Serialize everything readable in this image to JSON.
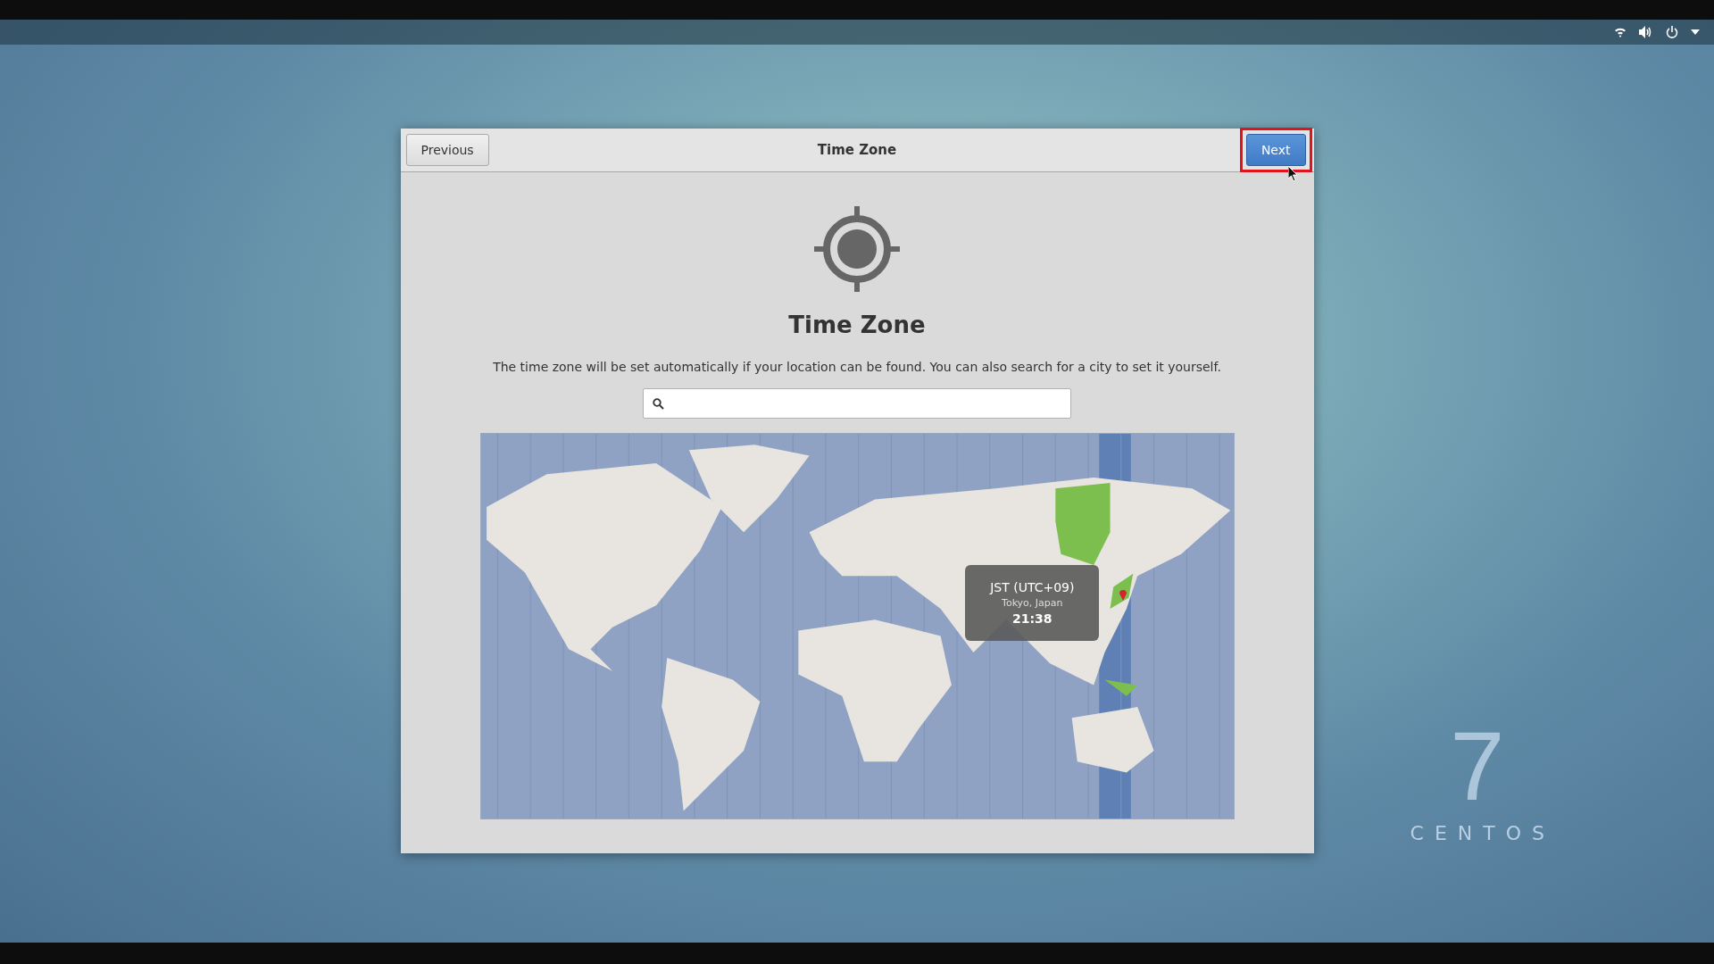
{
  "dialog": {
    "title": "Time Zone",
    "previous_button": "Previous",
    "next_button": "Next",
    "next_highlighted": true
  },
  "page": {
    "heading": "Time Zone",
    "description": "The time zone will be set automatically if your location can be found. You can also search for a city to set it yourself."
  },
  "map": {
    "tooltip": {
      "zone": "JST (UTC+09)",
      "city": "Tokyo, Japan",
      "time": "21:38"
    }
  },
  "branding": {
    "version": "7",
    "name": "CENTOS"
  }
}
